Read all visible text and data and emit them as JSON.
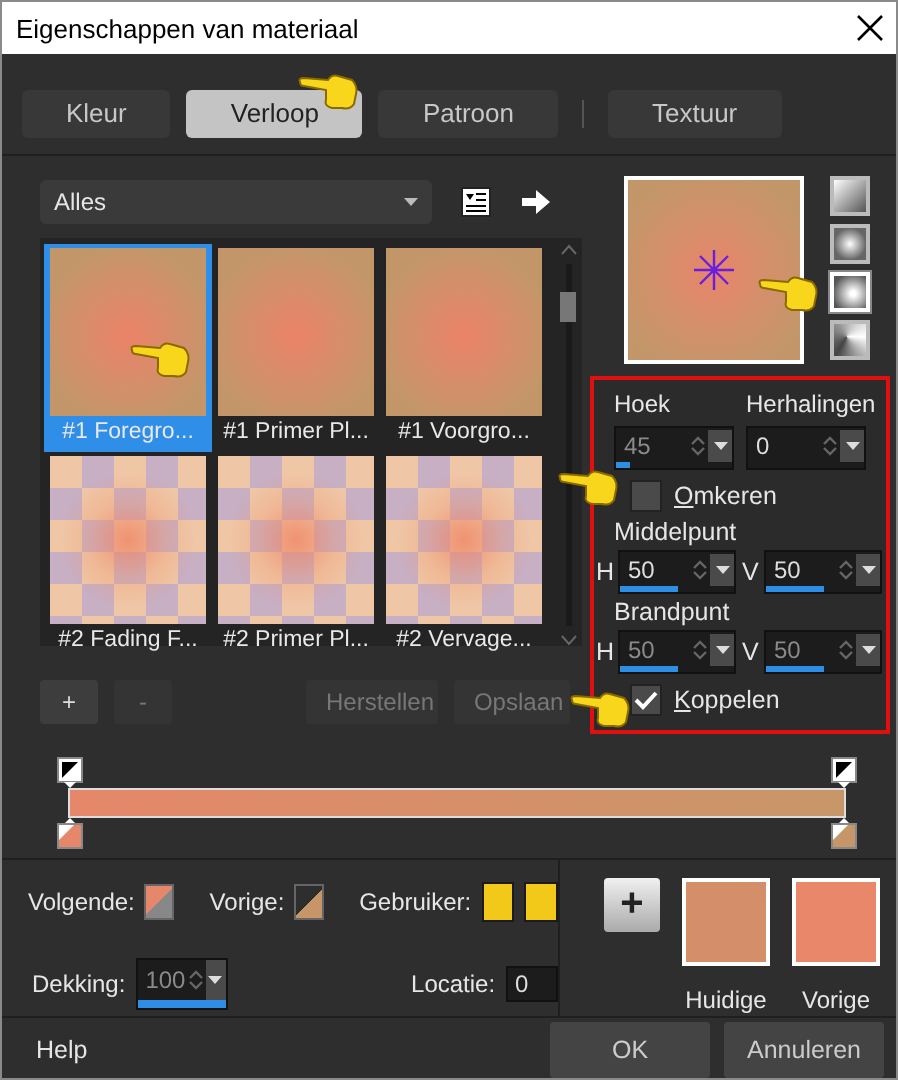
{
  "window": {
    "title": "Eigenschappen van materiaal"
  },
  "tabs": [
    {
      "label": "Kleur",
      "selected": false
    },
    {
      "label": "Verloop",
      "selected": true
    },
    {
      "label": "Patroon",
      "selected": false
    },
    {
      "label": "Textuur",
      "selected": false
    }
  ],
  "category_dropdown": {
    "value": "Alles"
  },
  "gradients": [
    {
      "label": "#1 Foregro...",
      "kind": "radial",
      "selected": true
    },
    {
      "label": "#1 Primer Pl...",
      "kind": "radial",
      "selected": false
    },
    {
      "label": "#1 Voorgro...",
      "kind": "radial",
      "selected": false
    },
    {
      "label": "#2 Fading F...",
      "kind": "checker",
      "selected": false
    },
    {
      "label": "#2 Primer Pl...",
      "kind": "checker",
      "selected": false
    },
    {
      "label": "#2 Vervage...",
      "kind": "checker",
      "selected": false
    }
  ],
  "gradient_buttons": [
    {
      "label": "+",
      "disabled": false
    },
    {
      "label": "-",
      "disabled": true
    },
    {
      "label": "Herstellen",
      "disabled": true
    },
    {
      "label": "Opslaan",
      "disabled": true
    }
  ],
  "styles": [
    {
      "kind": "linear",
      "selected": false
    },
    {
      "kind": "rectangular",
      "selected": false
    },
    {
      "kind": "radial",
      "selected": true
    },
    {
      "kind": "corner",
      "selected": false
    }
  ],
  "angle": {
    "label": "Hoek",
    "value": "45",
    "disabled": true,
    "level": 0.125
  },
  "repeats": {
    "label": "Herhalingen",
    "value": "0",
    "disabled": false,
    "level": 0
  },
  "reverse": {
    "label": "Omkeren",
    "checked": false
  },
  "center": {
    "label": "Middelpunt",
    "fields": [
      {
        "axis": "H",
        "value": "50",
        "disabled": false,
        "level": 0.5
      },
      {
        "axis": "V",
        "value": "50",
        "disabled": false,
        "level": 0.5
      }
    ]
  },
  "focal": {
    "label": "Brandpunt",
    "fields": [
      {
        "axis": "H",
        "value": "50",
        "disabled": true,
        "level": 0.5
      },
      {
        "axis": "V",
        "value": "50",
        "disabled": true,
        "level": 0.5
      }
    ]
  },
  "link": {
    "label": "Koppelen",
    "checked": true
  },
  "gradient_stops": [
    {
      "color": "#e5876a"
    },
    {
      "color": "#c79668"
    }
  ],
  "next": {
    "label": "Volgende:",
    "color": "#e5876a"
  },
  "previous": {
    "label": "Vorige:",
    "color": "#c79668"
  },
  "user": {
    "label": "Gebruiker:",
    "swatches": [
      {
        "color": "#f2c819"
      },
      {
        "color": "#f2c819"
      }
    ]
  },
  "opacity": {
    "label": "Dekking:",
    "value": "100",
    "level": 1
  },
  "location": {
    "label": "Locatie:",
    "value": "0"
  },
  "material": {
    "add": "+",
    "current": {
      "label": "Huidige",
      "color": "#d48f6a"
    },
    "previous": {
      "label": "Vorige",
      "color": "#e8876a"
    }
  },
  "footer": {
    "help": "Help",
    "ok": "OK",
    "cancel": "Annuleren"
  }
}
